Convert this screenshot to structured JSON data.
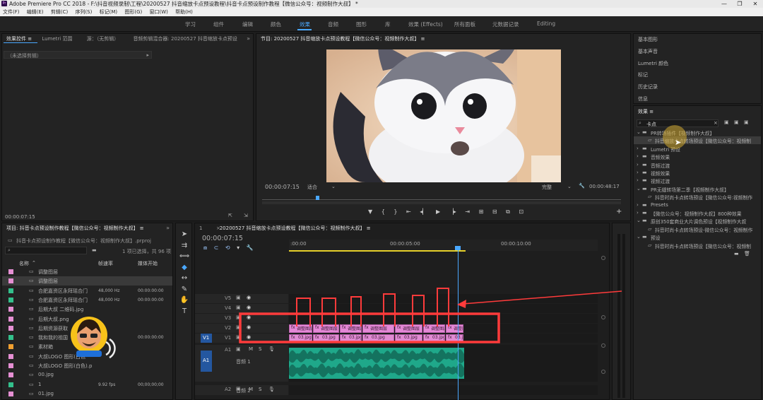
{
  "titlebar": {
    "app_title": "Adobe Premiere Pro CC 2018 - F:\\抖音视频录制\\工程\\20200527 抖音缩放卡点预设教程\\抖音卡点预设制作教程【微信公众号：视频制作大叔】 *",
    "minimize": "—",
    "maximize": "❐",
    "close": "✕"
  },
  "menu": [
    "文件(F)",
    "编辑(E)",
    "剪辑(C)",
    "序列(S)",
    "标记(M)",
    "图形(G)",
    "窗口(W)",
    "帮助(H)"
  ],
  "workspaces": [
    "学习",
    "组件",
    "编辑",
    "颜色",
    "效果",
    "音频",
    "图形",
    "库",
    "效果 (Effects)",
    "所有面板",
    "元数据记录",
    "Editing"
  ],
  "workspace_active": "效果",
  "source_panel": {
    "tabs": [
      "效果控件 ≡",
      "Lumetri 范围",
      "源：（无剪辑）",
      "音频剪辑混合器: 20200527 抖音缩放卡点预设"
    ],
    "no_clip": "（未选择剪辑）",
    "timecode": "00:00:07:15"
  },
  "program_monitor": {
    "title": "节目: 20200527 抖音缩放卡点预设教程【微信公众号：视频制作大叔】 ≡",
    "timecode_left": "00:00:07:15",
    "fit": "适合",
    "quality": "完整",
    "timecode_right": "00:00:48:17"
  },
  "project_panel": {
    "title": "项目: 抖音卡点预设制作教程【微信公众号：视频制作大叔】 ≡",
    "file": "抖音卡点预设制作教程【微信公众号：视频制作大叔】.prproj",
    "selection_info": "1 项已选择，共 96 项",
    "col_name": "名称",
    "col_rate": "帧速率",
    "col_start": "媒体开始",
    "items": [
      {
        "name": "调整图层",
        "rate": "",
        "start": "",
        "color": "#e58fd3"
      },
      {
        "name": "调整图层",
        "rate": "",
        "start": "",
        "color": "#e58fd3"
      },
      {
        "name": "合肥嘉资区永拜瑶合门",
        "rate": "48,000 Hz",
        "start": "00:00:00:00",
        "color": "#33c08c"
      },
      {
        "name": "合肥嘉资区永拜瑶合门",
        "rate": "48,000 Hz",
        "start": "00:00:00:00",
        "color": "#33c08c"
      },
      {
        "name": "后期大叔 二维码.jpg",
        "rate": "",
        "start": "",
        "color": "#e58fd3"
      },
      {
        "name": "后期大叔.png",
        "rate": "",
        "start": "",
        "color": "#e58fd3"
      },
      {
        "name": "后期资源获取",
        "rate": "",
        "start": "",
        "color": "#e58fd3"
      },
      {
        "name": "我和我的祖国",
        "rate": "",
        "start": "00:00:00:00",
        "color": "#33c08c"
      },
      {
        "name": "素材箱",
        "rate": "",
        "start": "",
        "color": "#f0a030"
      },
      {
        "name": "大叔LOGO 图形(白色",
        "rate": "",
        "start": "",
        "color": "#e58fd3"
      },
      {
        "name": "大叔LOGO 图形(白色).p",
        "rate": "",
        "start": "",
        "color": "#e58fd3"
      },
      {
        "name": "00.jpg",
        "rate": "",
        "start": "",
        "color": "#e58fd3"
      },
      {
        "name": "1",
        "rate": "9.92 fps",
        "start": "00;00;00;00",
        "color": "#33c08c"
      },
      {
        "name": "01.jpg",
        "rate": "",
        "start": "",
        "color": "#e58fd3"
      }
    ]
  },
  "timeline": {
    "tab_num": "1",
    "title": "20200527 抖音缩放卡点预设教程【微信公众号：视频制作大叔】 ≡",
    "timecode": "00:00:07:15",
    "ruler_labels": [
      ":00:00",
      "00:00:05:00",
      "00:00:10:00"
    ],
    "video_tracks": [
      "V5",
      "V4",
      "V3",
      "V2",
      "V1"
    ],
    "audio_tracks": [
      "A1",
      "A2"
    ],
    "audio_names": [
      "音频 1",
      "音频 2"
    ],
    "src_v": "V1",
    "src_a": "A1",
    "clip_label": "调整图层",
    "clip_fx": "fx",
    "clip_label_v1": "03.jpg"
  },
  "effects_panel": {
    "panel_list": [
      "基本图形",
      "基本声音",
      "Lumetri 颜色",
      "标记",
      "历史记录",
      "信息"
    ],
    "title": "效果 ≡",
    "search_value": "卡点",
    "tree": [
      {
        "label": "PR转场插件【视频制作大叔】",
        "level": 0,
        "open": true
      },
      {
        "label": "抖音缩放卡点转场预设【微信公众号：视频制",
        "level": 1,
        "open": false
      },
      {
        "label": "Lumetri 预设",
        "level": 0,
        "open": false
      },
      {
        "label": "音频效果",
        "level": 0,
        "open": false
      },
      {
        "label": "音频过渡",
        "level": 0,
        "open": false
      },
      {
        "label": "视频效果",
        "level": 0,
        "open": false
      },
      {
        "label": "视频过渡",
        "level": 0,
        "open": false
      },
      {
        "label": "PR无缝转场第二季【视频制作大叔】",
        "level": 0,
        "open": true
      },
      {
        "label": "抖音时尚卡点转场预设【微信公众号:视频制作",
        "level": 1,
        "open": false
      },
      {
        "label": "Presets",
        "level": 0,
        "open": false
      },
      {
        "label": "【微信公众号：视频制作大叔】800种效果",
        "level": 0,
        "open": false
      },
      {
        "label": "原创350套商业大片调色预设【视频制作大叔",
        "level": 0,
        "open": true
      },
      {
        "label": "抖音时尚卡点转场预设-微信公众号：视频制作",
        "level": 1,
        "open": false
      },
      {
        "label": "预设",
        "level": 0,
        "open": true
      },
      {
        "label": "抖音时尚卡点转场预设【微信公众号：视频制",
        "level": 1,
        "open": false
      }
    ]
  },
  "colors": {
    "accent": "#2d8cf0",
    "annotation": "#ff3b3b",
    "clip_pink": "#e488d6",
    "audio_green": "#1fa88a",
    "playhead": "#4aa8ff"
  }
}
